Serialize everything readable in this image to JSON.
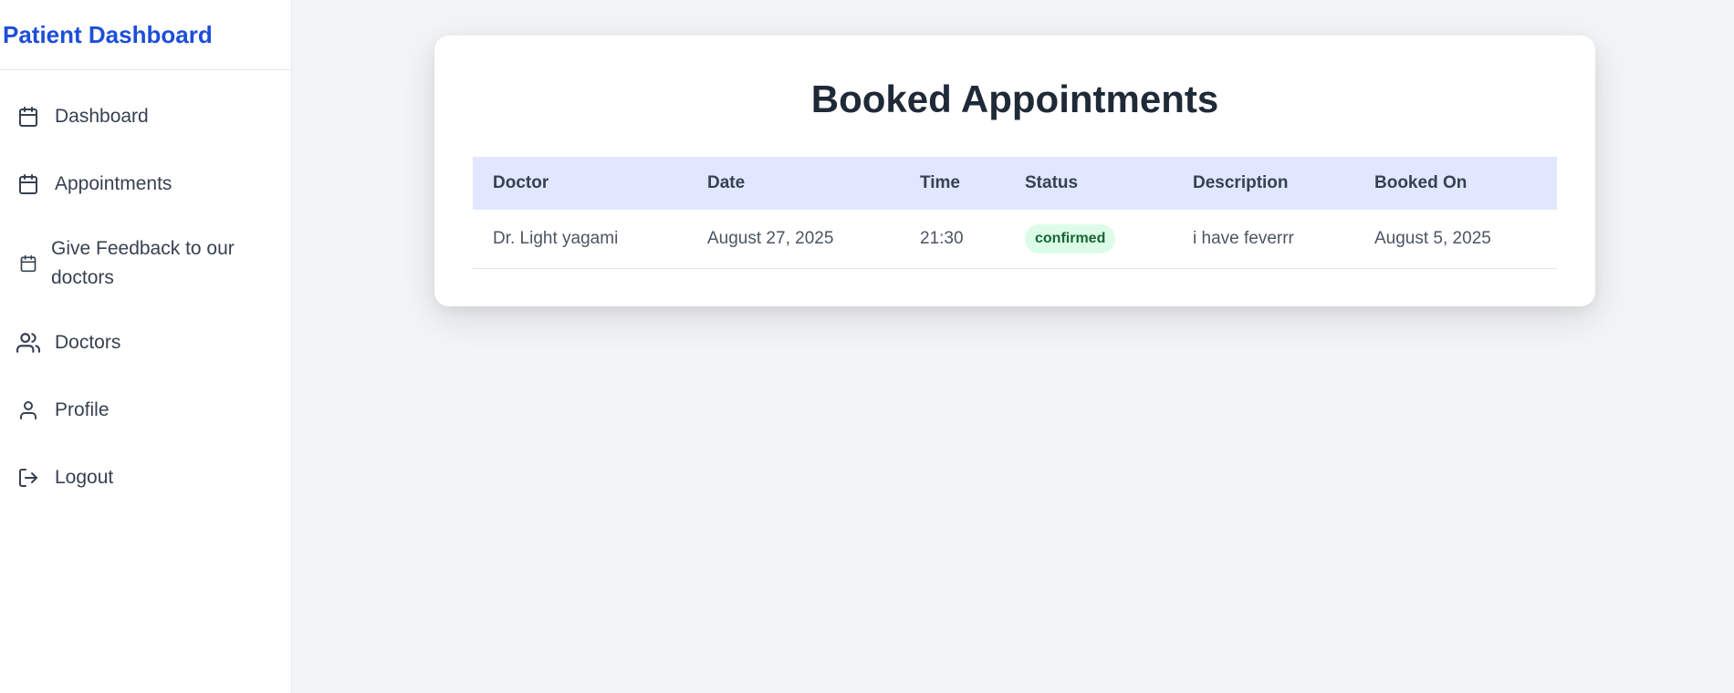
{
  "sidebar": {
    "brand": "Patient Dashboard",
    "items": [
      {
        "label": "Dashboard",
        "icon": "calendar-icon"
      },
      {
        "label": "Appointments",
        "icon": "calendar-icon"
      },
      {
        "label": "Give Feedback to our doctors",
        "icon": "calendar-icon"
      },
      {
        "label": "Doctors",
        "icon": "users-icon"
      },
      {
        "label": "Profile",
        "icon": "user-icon"
      },
      {
        "label": "Logout",
        "icon": "logout-icon"
      }
    ]
  },
  "main": {
    "title": "Booked Appointments",
    "table": {
      "headers": [
        "Doctor",
        "Date",
        "Time",
        "Status",
        "Description",
        "Booked On"
      ],
      "rows": [
        {
          "doctor": "Dr. Light yagami",
          "date": "August 27, 2025",
          "time": "21:30",
          "status": "confirmed",
          "description": "i have feverrr",
          "booked_on": "August 5, 2025"
        }
      ]
    }
  },
  "colors": {
    "brand": "#1d4ed8",
    "header_row": "#e0e7ff",
    "badge_bg": "#dcfce7",
    "badge_text": "#166534"
  }
}
